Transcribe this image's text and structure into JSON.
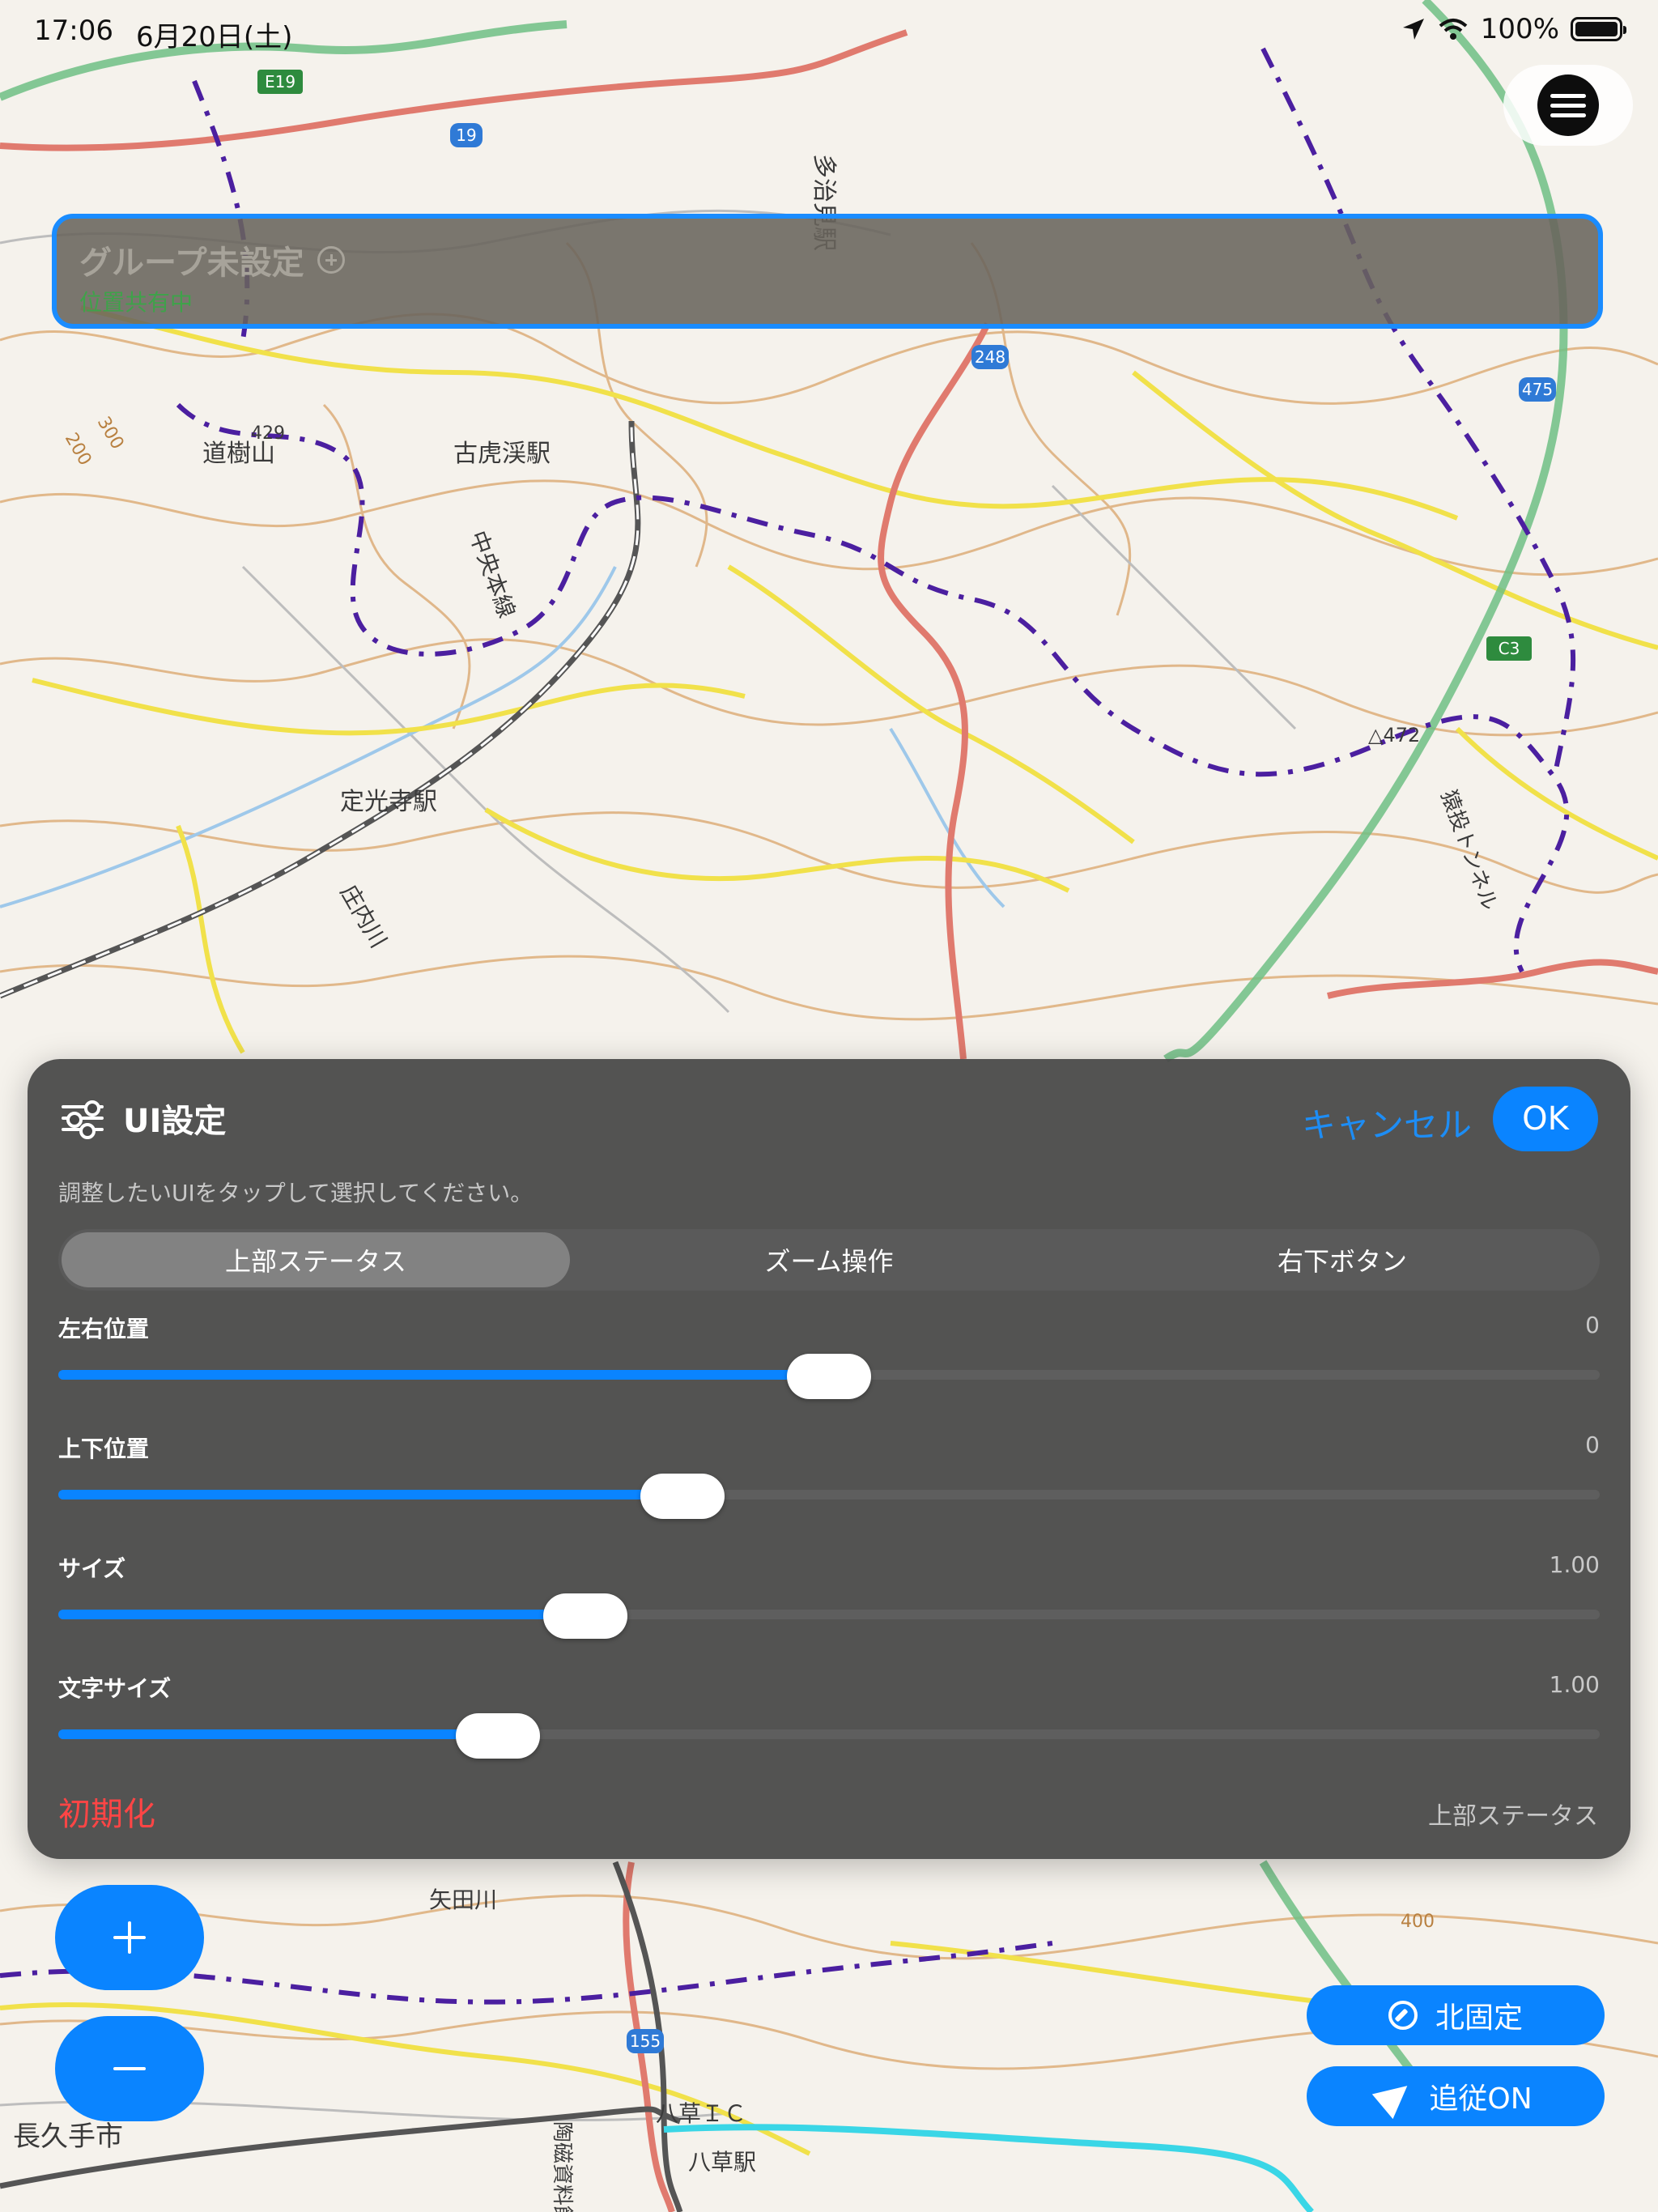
{
  "status_bar": {
    "time": "17:06",
    "date": "6月20日(土)",
    "battery": "100%"
  },
  "map": {
    "labels": {
      "tajimi_station": "多治見駅",
      "kokeikei_station": "古虎渓駅",
      "mount": "道樹山",
      "mount_elev": "429",
      "jokoji_station": "定光寺駅",
      "chuo_line": "中央本線",
      "shonai_river": "庄内川",
      "tunnel": "猿投トンネル",
      "peak": "△472",
      "yatagawa": "矢田川",
      "nagakute": "長久手市",
      "yakusa_ic": "八草ＩＣ",
      "yakusa_station": "八草駅",
      "toji_museum": "陶磁資料館",
      "contour_300": "300",
      "contour_200": "200",
      "contour_400": "400",
      "route_19": "19",
      "route_248": "248",
      "route_475": "475",
      "route_155": "155",
      "e19": "E19",
      "c3": "C3"
    }
  },
  "menu_button": {
    "icon": "hamburger-menu-icon"
  },
  "top_status": {
    "group_label": "グループ未設定",
    "sub_label": "位置共有中"
  },
  "ui_settings": {
    "title": "UI設定",
    "cancel": "キャンセル",
    "ok": "OK",
    "hint": "調整したいUIをタップして選択してください。",
    "tabs": [
      {
        "label": "上部ステータス",
        "active": true
      },
      {
        "label": "ズーム操作",
        "active": false
      },
      {
        "label": "右下ボタン",
        "active": false
      }
    ],
    "sliders": [
      {
        "label": "左右位置",
        "value": "0",
        "fraction": 0.5
      },
      {
        "label": "上下位置",
        "value": "0",
        "fraction": 0.405
      },
      {
        "label": "サイズ",
        "value": "1.00",
        "fraction": 0.342
      },
      {
        "label": "文字サイズ",
        "value": "1.00",
        "fraction": 0.285
      }
    ],
    "reset": "初期化",
    "selected_target": "上部ステータス"
  },
  "zoom": {
    "in_icon": "plus-icon",
    "out_icon": "minus-icon"
  },
  "buttons": {
    "north_fixed": "北固定",
    "follow_on": "追従ON"
  },
  "colors": {
    "accent": "#0a84ff",
    "status_border": "#1a8cff",
    "reset": "#ff4545",
    "sharing_green": "#3fa24a"
  }
}
